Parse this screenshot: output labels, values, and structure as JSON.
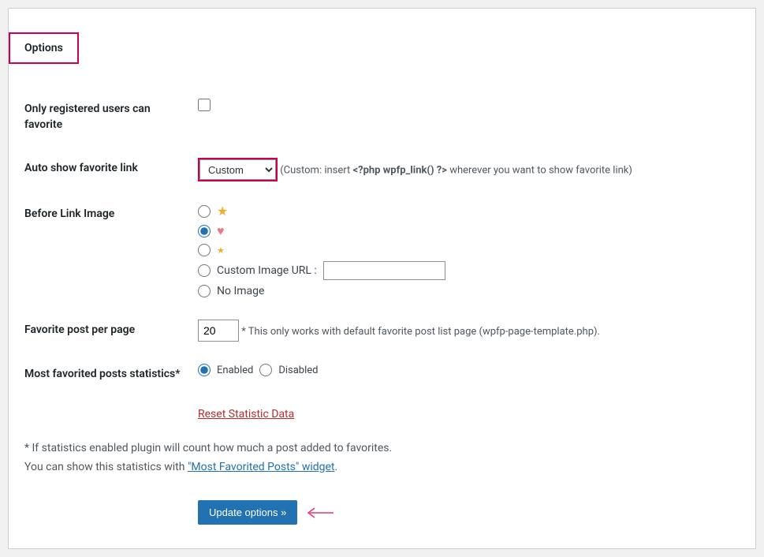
{
  "tab": {
    "label": "Options"
  },
  "only_registered": {
    "label": "Only registered users can favorite"
  },
  "auto_show": {
    "label": "Auto show favorite link",
    "selected": "Custom",
    "hint_prefix": "(Custom: insert ",
    "hint_code": "<?php wpfp_link() ?>",
    "hint_suffix": " wherever you want to show favorite link)"
  },
  "before_link": {
    "label": "Before Link Image",
    "custom_label": "Custom Image URL :",
    "noimage_label": "No Image"
  },
  "per_page": {
    "label": "Favorite post per page",
    "value": "20",
    "note": "* This only works with default favorite post list page (wpfp-page-template.php)."
  },
  "stats": {
    "label": "Most favorited posts statistics*",
    "enabled_label": "Enabled",
    "disabled_label": "Disabled",
    "reset_label": "Reset Statistic Data"
  },
  "footer": {
    "line1": "* If statistics enabled plugin will count how much a post added to favorites.",
    "line2a": "You can show this statistics with ",
    "link": "\"Most Favorited Posts\" widget",
    "line2b": "."
  },
  "submit": {
    "label": "Update options »"
  }
}
